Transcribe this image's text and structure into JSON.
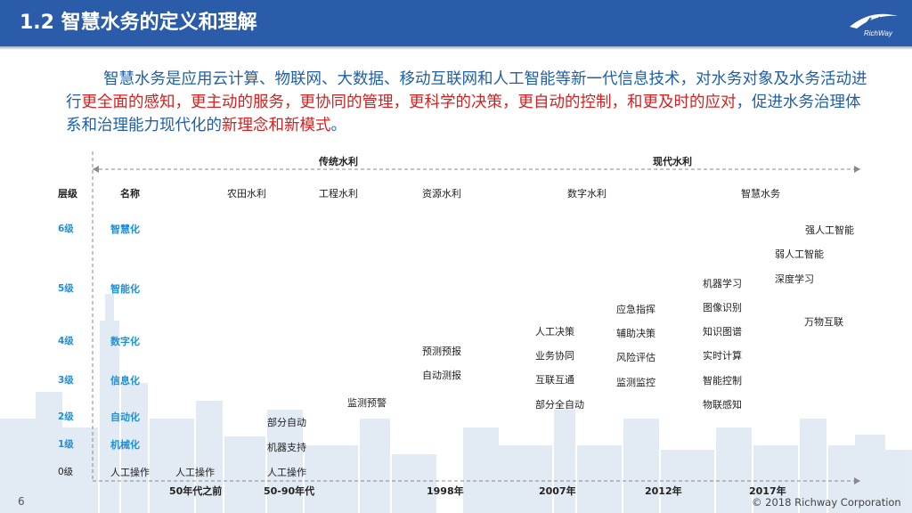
{
  "header": {
    "title": "1.2 智慧水务的定义和理解",
    "logo_text": "RichWay"
  },
  "intro": {
    "p1": "智慧水务是应用云计算、物联网、大数据、移动互联网和人工智能等新一代信息技术，对水务对象及水务活动进行",
    "p2": "更全面的感知，更主动的服务，更协同的管理，更科学的决策，更自动的控制，和更及时的应对",
    "p3": "，促进水务治理体系和治理能力现代化的",
    "p4": "新理念和新模式",
    "p5": "。"
  },
  "timeline": {
    "traditional": "传统水利",
    "modern": "现代水利",
    "col_level": "层级",
    "col_name": "名称",
    "eras": [
      "农田水利",
      "工程水利",
      "资源水利",
      "数字水利",
      "智慧水务"
    ],
    "levels": [
      "6级",
      "5级",
      "4级",
      "3级",
      "2级",
      "1级",
      "0级"
    ],
    "names": [
      "智慧化",
      "智能化",
      "数字化",
      "信息化",
      "自动化",
      "机械化",
      "人工操作"
    ],
    "years": [
      "50年代之前",
      "50-90年代",
      "1998年",
      "2007年",
      "2012年",
      "2017年"
    ]
  },
  "cells": {
    "c50_before": "人工操作",
    "c5090": [
      "部分自动",
      "机器支持",
      "人工操作"
    ],
    "c_monitor": "监测预警",
    "c1998": [
      "预测预报",
      "自动测报"
    ],
    "c2007": [
      "人工决策",
      "业务协同",
      "互联互通",
      "部分全自动"
    ],
    "c2012": [
      "应急指挥",
      "辅助决策",
      "风险评估",
      "监测监控"
    ],
    "c2017": [
      "机器学习",
      "图像识别",
      "知识图谱",
      "实时计算",
      "智能控制",
      "物联感知"
    ],
    "cfuture": [
      "强人工智能",
      "弱人工智能",
      "深度学习",
      "万物互联"
    ]
  },
  "footer": {
    "page": "6",
    "copyright": "© 2018 Richway Corporation"
  },
  "colors": {
    "header_bg": "#2a5caa",
    "blue_text": "#1f5fa8",
    "red_text": "#d42020",
    "level_blue": "#1f8fd6"
  }
}
